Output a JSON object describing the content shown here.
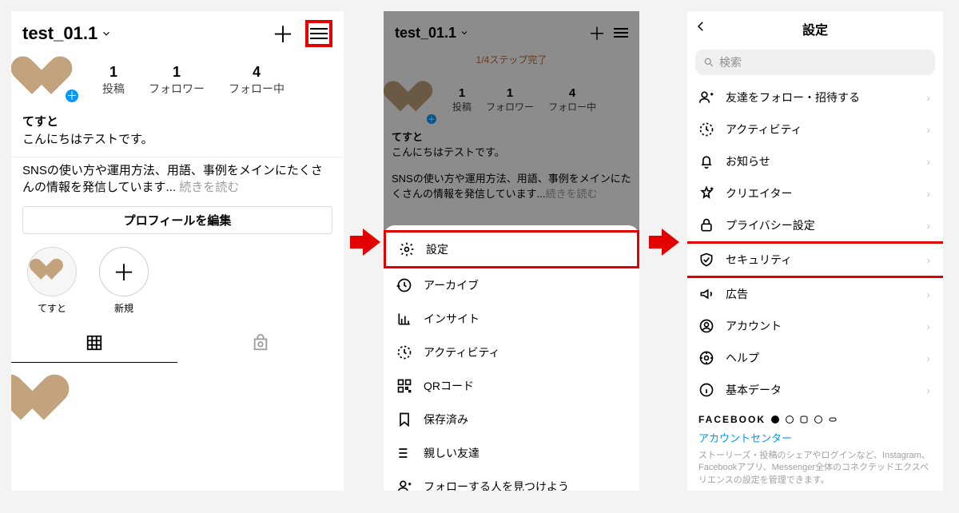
{
  "panel1": {
    "username": "test_01.1",
    "stats": [
      {
        "n": "1",
        "l": "投稿"
      },
      {
        "n": "1",
        "l": "フォロワー"
      },
      {
        "n": "4",
        "l": "フォロー中"
      }
    ],
    "displayName": "てすと",
    "bio": "こんにちはテストです。",
    "desc": "SNSの使い方や運用方法、用語、事例をメインにたくさんの情報を発信しています...",
    "more": "続きを読む",
    "editProfile": "プロフィールを編集",
    "stories": [
      {
        "label": "てすと"
      },
      {
        "label": "新規"
      }
    ]
  },
  "panel2": {
    "username": "test_01.1",
    "stepBanner": "1/4ステップ完了",
    "menu": [
      {
        "icon": "gear",
        "label": "設定"
      },
      {
        "icon": "archive",
        "label": "アーカイブ"
      },
      {
        "icon": "insights",
        "label": "インサイト"
      },
      {
        "icon": "activity",
        "label": "アクティビティ"
      },
      {
        "icon": "qr",
        "label": "QRコード"
      },
      {
        "icon": "saved",
        "label": "保存済み"
      },
      {
        "icon": "close-friends",
        "label": "親しい友達"
      },
      {
        "icon": "discover",
        "label": "フォローする人を見つけよう"
      }
    ]
  },
  "panel3": {
    "title": "設定",
    "searchPlaceholder": "検索",
    "items": [
      {
        "icon": "invite",
        "label": "友達をフォロー・招待する"
      },
      {
        "icon": "activity",
        "label": "アクティビティ"
      },
      {
        "icon": "bell",
        "label": "お知らせ"
      },
      {
        "icon": "creator",
        "label": "クリエイター"
      },
      {
        "icon": "lock",
        "label": "プライバシー設定"
      },
      {
        "icon": "shield",
        "label": "セキュリティ"
      },
      {
        "icon": "ads",
        "label": "広告"
      },
      {
        "icon": "account",
        "label": "アカウント"
      },
      {
        "icon": "help",
        "label": "ヘルプ"
      },
      {
        "icon": "info",
        "label": "基本データ"
      }
    ],
    "facebookLabel": "FACEBOOK",
    "accountCenter": "アカウントセンター",
    "footerNote": "ストーリーズ・投稿のシェアやログインなど、Instagram、Facebookアプリ、Messenger全体のコネクテッドエクスペリエンスの設定を管理できます。"
  }
}
